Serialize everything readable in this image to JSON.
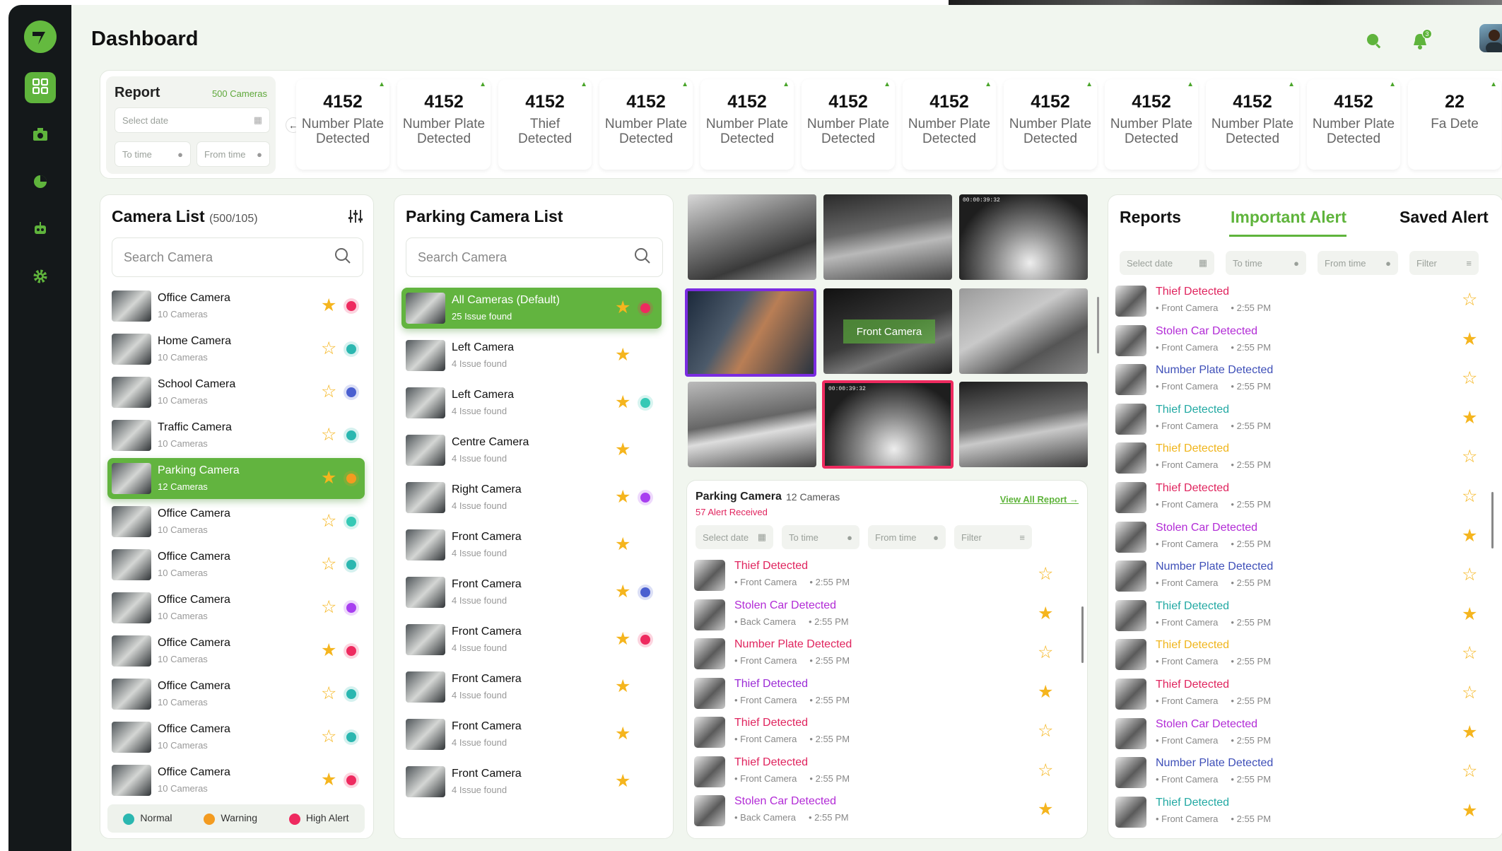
{
  "colors": {
    "accent": "#5fb43c",
    "sidebar": "#14181a",
    "normal": "#2bb7b0",
    "warning": "#f39b20",
    "high_alert": "#ee2a5f"
  },
  "sidebar": {
    "items": [
      {
        "icon": "dashboard-icon",
        "active": true
      },
      {
        "icon": "camera-icon"
      },
      {
        "icon": "pie-chart-icon"
      },
      {
        "icon": "robot-icon"
      },
      {
        "icon": "gear-icon"
      }
    ]
  },
  "header": {
    "title": "Dashboard",
    "notification_count": "3"
  },
  "report": {
    "title": "Report",
    "count": "500 Cameras",
    "select_date": "Select date",
    "to_time": "To time",
    "from_time": "From time",
    "stats": [
      {
        "value": "4152",
        "label": "Number Plate Detected"
      },
      {
        "value": "4152",
        "label": "Number Plate Detected"
      },
      {
        "value": "4152",
        "label": "Thief Detected"
      },
      {
        "value": "4152",
        "label": "Number Plate Detected"
      },
      {
        "value": "4152",
        "label": "Number Plate Detected"
      },
      {
        "value": "4152",
        "label": "Number Plate Detected"
      },
      {
        "value": "4152",
        "label": "Number Plate Detected"
      },
      {
        "value": "4152",
        "label": "Number Plate Detected"
      },
      {
        "value": "4152",
        "label": "Number Plate Detected"
      },
      {
        "value": "4152",
        "label": "Number Plate Detected"
      },
      {
        "value": "4152",
        "label": "Number Plate Detected"
      },
      {
        "value": "22",
        "label": "Fa Dete"
      }
    ]
  },
  "camera_list": {
    "title": "Camera List",
    "count": "(500/105)",
    "search_placeholder": "Search Camera",
    "items": [
      {
        "name": "Office Camera",
        "sub": "10 Cameras",
        "starred": true,
        "status": "high_alert"
      },
      {
        "name": "Home Camera",
        "sub": "10 Cameras",
        "starred": false,
        "status": "normal"
      },
      {
        "name": "School Camera",
        "sub": "10 Cameras",
        "starred": false,
        "status": "blue"
      },
      {
        "name": "Traffic Camera",
        "sub": "10 Cameras",
        "starred": false,
        "status": "normal"
      },
      {
        "name": "Parking Camera",
        "sub": "12 Cameras",
        "starred": true,
        "status": "warning",
        "selected": true
      },
      {
        "name": "Office Camera",
        "sub": "10 Cameras",
        "starred": false,
        "status": "teal"
      },
      {
        "name": "Office Camera",
        "sub": "10 Cameras",
        "starred": false,
        "status": "normal"
      },
      {
        "name": "Office Camera",
        "sub": "10 Cameras",
        "starred": false,
        "status": "purple"
      },
      {
        "name": "Office Camera",
        "sub": "10 Cameras",
        "starred": true,
        "status": "high_alert"
      },
      {
        "name": "Office Camera",
        "sub": "10 Cameras",
        "starred": false,
        "status": "normal"
      },
      {
        "name": "Office Camera",
        "sub": "10 Cameras",
        "starred": false,
        "status": "normal"
      },
      {
        "name": "Office Camera",
        "sub": "10 Cameras",
        "starred": true,
        "status": "high_alert"
      }
    ],
    "legend": {
      "normal": "Normal",
      "warning": "Warning",
      "high_alert": "High Alert"
    }
  },
  "parking_list": {
    "title": "Parking Camera List",
    "search_placeholder": "Search Camera",
    "items": [
      {
        "name": "All Cameras  (Default)",
        "sub": "25 Issue found",
        "starred": true,
        "status": "high_alert",
        "selected": true
      },
      {
        "name": "Left Camera",
        "sub": "4 Issue found",
        "starred": true,
        "status": ""
      },
      {
        "name": "Left Camera",
        "sub": "4 Issue found",
        "starred": true,
        "status": "teal"
      },
      {
        "name": "Centre Camera",
        "sub": "4 Issue found",
        "starred": true,
        "status": ""
      },
      {
        "name": "Right Camera",
        "sub": "4 Issue found",
        "starred": true,
        "status": "purple"
      },
      {
        "name": "Front Camera",
        "sub": "4 Issue found",
        "starred": true,
        "status": ""
      },
      {
        "name": "Front Camera",
        "sub": "4 Issue found",
        "starred": true,
        "status": "blue"
      },
      {
        "name": "Front Camera",
        "sub": "4 Issue found",
        "starred": true,
        "status": "high_alert"
      },
      {
        "name": "Front Camera",
        "sub": "4 Issue found",
        "starred": true,
        "status": ""
      },
      {
        "name": "Front Camera",
        "sub": "4 Issue found",
        "starred": true,
        "status": ""
      },
      {
        "name": "Front Camera",
        "sub": "4 Issue found",
        "starred": true,
        "status": ""
      }
    ]
  },
  "feeds": {
    "label": "Front Camera",
    "timestamp": "00:00:39:32"
  },
  "parking_alerts": {
    "title": "Parking Camera",
    "count": "12 Cameras",
    "received": "57 Alert Received",
    "view_all": "View All Report",
    "select_date": "Select date",
    "to_time": "To time",
    "from_time": "From time",
    "filter": "Filter",
    "items": [
      {
        "title": "Thief Detected",
        "cam": "Front Camera",
        "time": "2:55 PM",
        "color": "#e0245e",
        "starred": false
      },
      {
        "title": "Stolen Car Detected",
        "cam": "Back Camera",
        "time": "2:55 PM",
        "color": "#b22bd6",
        "starred": true
      },
      {
        "title": "Number Plate Detected",
        "cam": "Front Camera",
        "time": "2:55 PM",
        "color": "#e0245e",
        "starred": false
      },
      {
        "title": "Thief Detected",
        "cam": "Front Camera",
        "time": "2:55 PM",
        "color": "#9b2bd6",
        "starred": true
      },
      {
        "title": "Thief Detected",
        "cam": "Front Camera",
        "time": "2:55 PM",
        "color": "#e0245e",
        "starred": false
      },
      {
        "title": "Thief Detected",
        "cam": "Front Camera",
        "time": "2:55 PM",
        "color": "#e0245e",
        "starred": false
      },
      {
        "title": "Stolen Car Detected",
        "cam": "Back Camera",
        "time": "2:55 PM",
        "color": "#b22bd6",
        "starred": true
      }
    ]
  },
  "reports": {
    "tabs": [
      "Reports",
      "Important Alert",
      "Saved Alert"
    ],
    "select_date": "Select date",
    "to_time": "To time",
    "from_time": "From time",
    "filter": "Filter",
    "items": [
      {
        "title": "Thief Detected",
        "cam": "Front Camera",
        "time": "2:55 PM",
        "color": "#e0245e",
        "starred": false
      },
      {
        "title": "Stolen Car Detected",
        "cam": "Front Camera",
        "time": "2:55 PM",
        "color": "#b22bd6",
        "starred": true
      },
      {
        "title": "Number Plate Detected",
        "cam": "Front Camera",
        "time": "2:55 PM",
        "color": "#3e4fb8",
        "starred": false
      },
      {
        "title": "Thief Detected",
        "cam": "Front Camera",
        "time": "2:55 PM",
        "color": "#22a9a3",
        "starred": true
      },
      {
        "title": "Thief Detected",
        "cam": "Front Camera",
        "time": "2:55 PM",
        "color": "#f0b51c",
        "starred": false
      },
      {
        "title": "Thief Detected",
        "cam": "Front Camera",
        "time": "2:55 PM",
        "color": "#e0245e",
        "starred": false
      },
      {
        "title": "Stolen Car Detected",
        "cam": "Front Camera",
        "time": "2:55 PM",
        "color": "#b22bd6",
        "starred": true
      },
      {
        "title": "Number Plate Detected",
        "cam": "Front Camera",
        "time": "2:55 PM",
        "color": "#3e4fb8",
        "starred": false
      },
      {
        "title": "Thief Detected",
        "cam": "Front Camera",
        "time": "2:55 PM",
        "color": "#22a9a3",
        "starred": true
      },
      {
        "title": "Thief Detected",
        "cam": "Front Camera",
        "time": "2:55 PM",
        "color": "#f0b51c",
        "starred": false
      },
      {
        "title": "Thief Detected",
        "cam": "Front Camera",
        "time": "2:55 PM",
        "color": "#e0245e",
        "starred": false
      },
      {
        "title": "Stolen Car Detected",
        "cam": "Front Camera",
        "time": "2:55 PM",
        "color": "#b22bd6",
        "starred": true
      },
      {
        "title": "Number Plate Detected",
        "cam": "Front Camera",
        "time": "2:55 PM",
        "color": "#3e4fb8",
        "starred": false
      },
      {
        "title": "Thief Detected",
        "cam": "Front Camera",
        "time": "2:55 PM",
        "color": "#22a9a3",
        "starred": true
      }
    ]
  }
}
